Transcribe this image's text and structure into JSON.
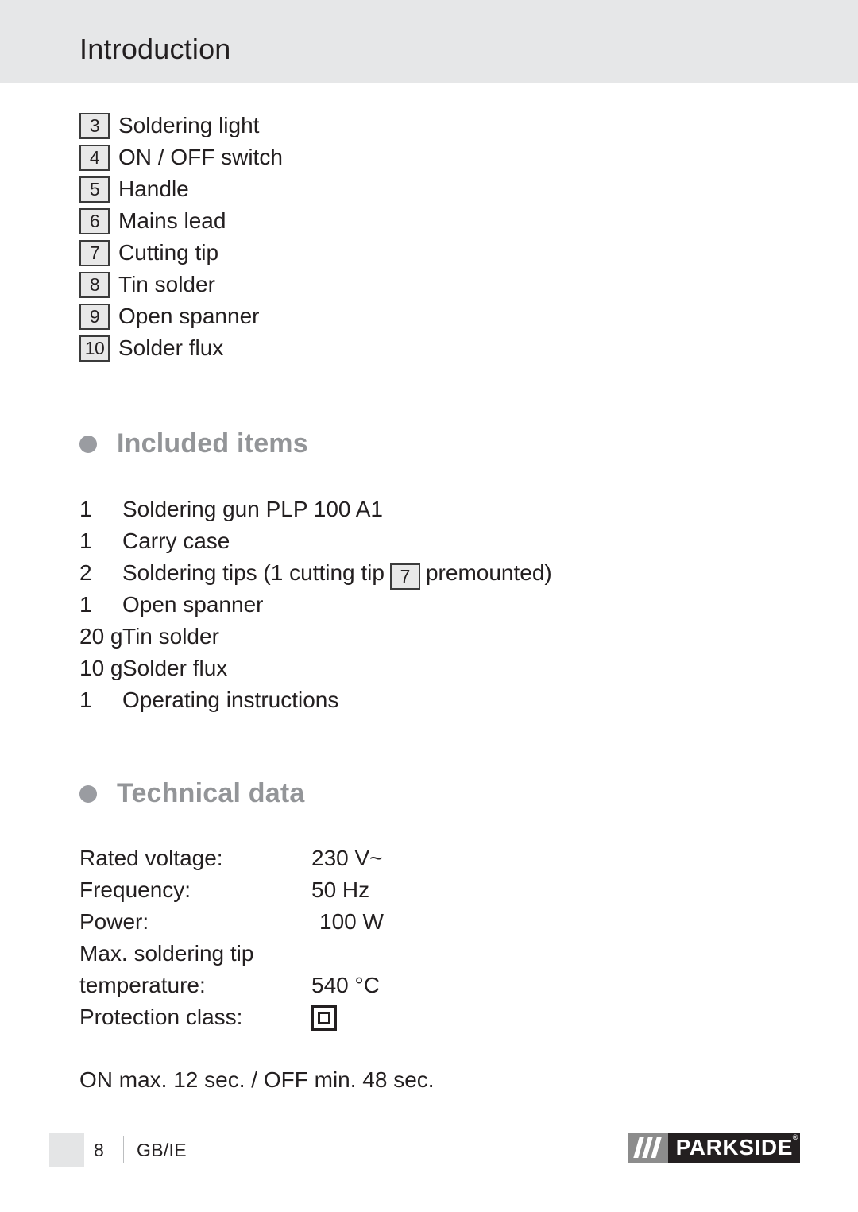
{
  "header": {
    "title": "Introduction"
  },
  "parts_list": [
    {
      "num": "3",
      "label": "Soldering light"
    },
    {
      "num": "4",
      "label": "ON / OFF switch"
    },
    {
      "num": "5",
      "label": "Handle"
    },
    {
      "num": "6",
      "label": "Mains lead"
    },
    {
      "num": "7",
      "label": "Cutting tip"
    },
    {
      "num": "8",
      "label": "Tin solder"
    },
    {
      "num": "9",
      "label": "Open spanner"
    },
    {
      "num": "10",
      "label": "Solder flux"
    }
  ],
  "included_items": {
    "heading": "Included items",
    "bullet": "filled-circle",
    "rows": [
      {
        "qty": "1",
        "text": "Soldering gun PLP 100 A1"
      },
      {
        "qty": "1",
        "text": "Carry case"
      },
      {
        "qty": "2",
        "text_before": "Soldering tips (1 cutting tip",
        "boxed_ref": "7",
        "text_after": "premounted)"
      },
      {
        "qty": "1",
        "text": "Open spanner"
      },
      {
        "qty": "20 g",
        "text": "Tin solder"
      },
      {
        "qty": "10 g",
        "text": "Solder flux"
      },
      {
        "qty": "1",
        "text": "Operating instructions"
      }
    ]
  },
  "technical_data": {
    "heading": "Technical data",
    "bullet": "filled-circle",
    "rows": [
      {
        "label": "Rated voltage:",
        "value": "230 V~"
      },
      {
        "label": "Frequency:",
        "value": "50 Hz"
      },
      {
        "label": "Power:",
        "value": "100 W"
      },
      {
        "label": "Max. soldering tip",
        "value": ""
      },
      {
        "label": "temperature:",
        "value": "540 °C"
      },
      {
        "label": "Protection class:",
        "value": "class-II-symbol"
      }
    ],
    "duty_cycle": "ON max. 12 sec. / OFF min. 48 sec."
  },
  "footer": {
    "page_number": "8",
    "locale": "GB/IE",
    "logo_text": "PARKSIDE",
    "logo_registered": "®"
  },
  "colors": {
    "header_band": "#e6e7e8",
    "heading_gray": "#939598",
    "bullet_gray": "#9a9ca1",
    "text": "#231f20",
    "box_fill": "#e8e8e8",
    "box_border": "#3b3b3b",
    "logo_dark": "#231f20",
    "logo_gray": "#8c8c8c"
  }
}
